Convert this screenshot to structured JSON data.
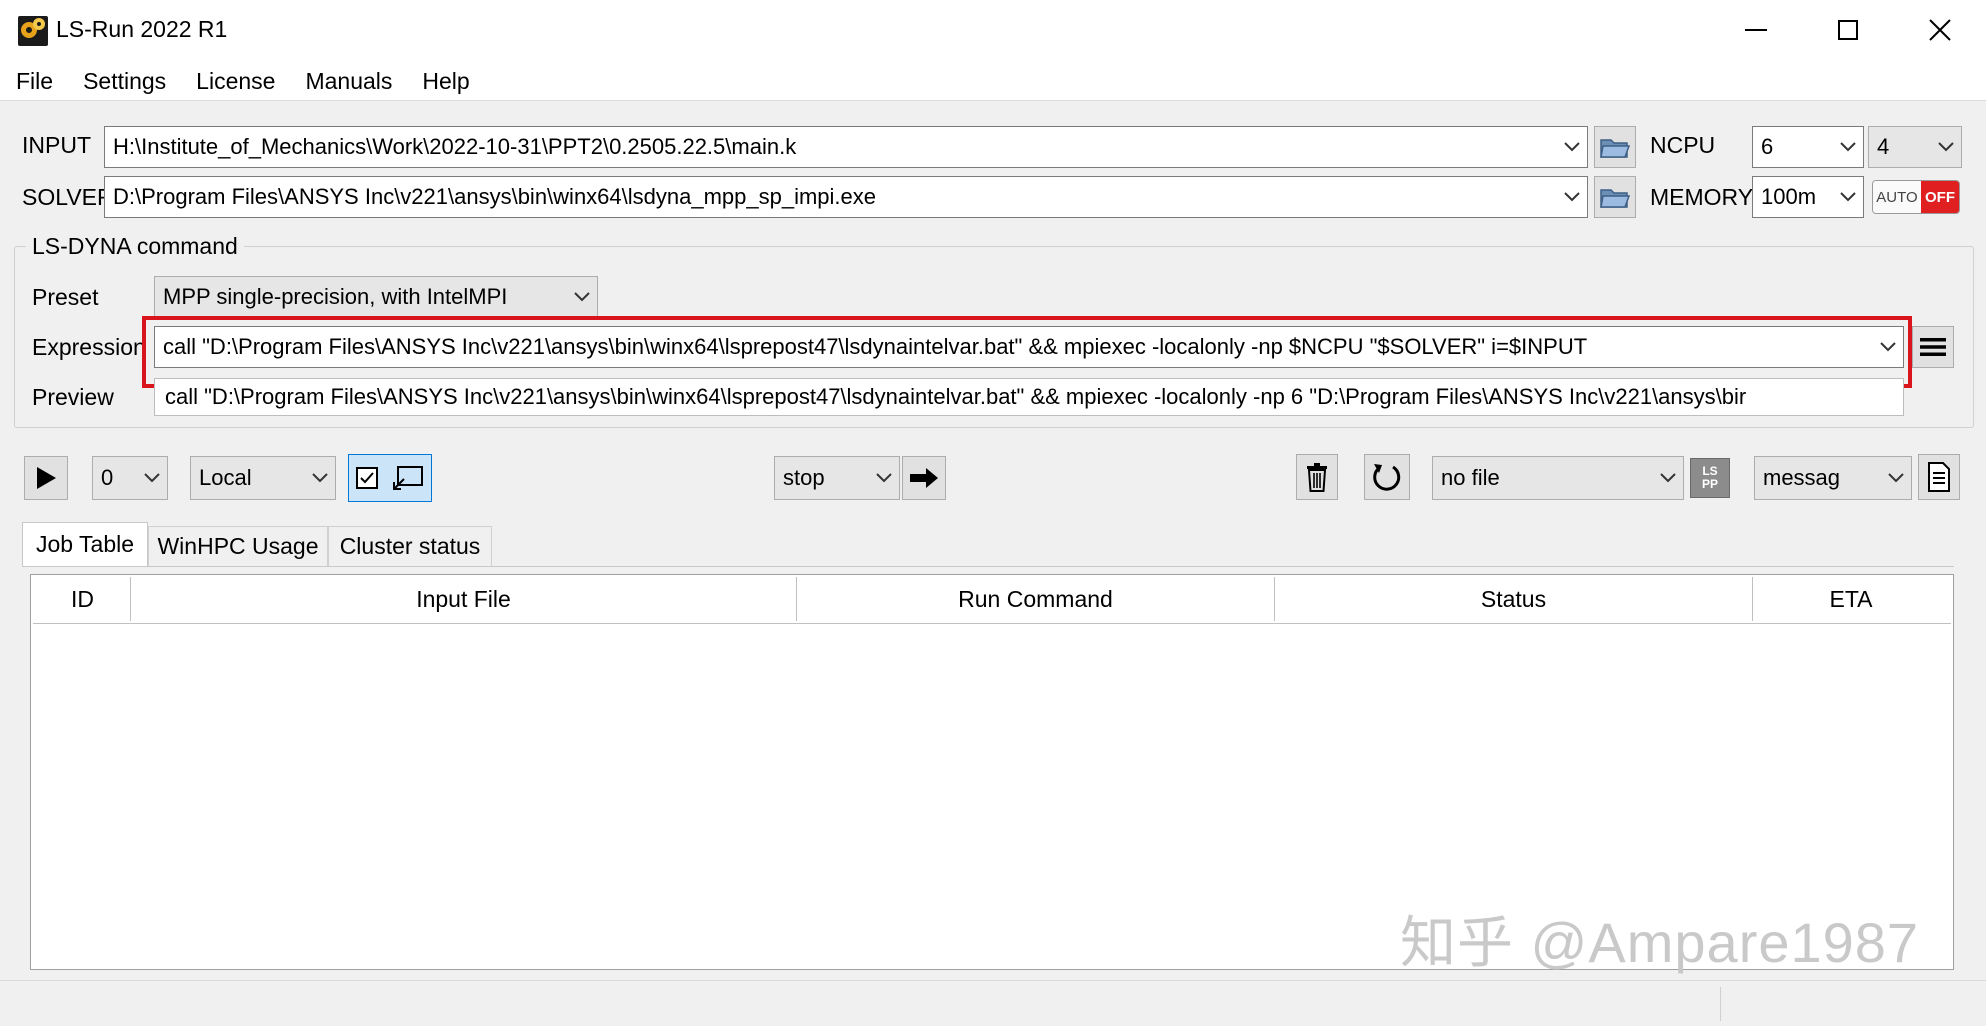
{
  "window": {
    "title": "LS-Run 2022 R1",
    "minimize_glyph": "—",
    "maximize_glyph": "☐",
    "close_glyph": "✕"
  },
  "menu": [
    "File",
    "Settings",
    "License",
    "Manuals",
    "Help"
  ],
  "input": {
    "label": "INPUT",
    "value": "H:\\Institute_of_Mechanics\\Work\\2022-10-31\\PPT2\\0.2505.22.5\\main.k"
  },
  "solver": {
    "label": "SOLVER",
    "value": "D:\\Program Files\\ANSYS Inc\\v221\\ansys\\bin\\winx64\\lsdyna_mpp_sp_impi.exe"
  },
  "ncpu": {
    "label": "NCPU",
    "value": "6",
    "value2": "4"
  },
  "memory": {
    "label": "MEMORY",
    "value": "100m",
    "auto_label": "AUTO",
    "off_label": "OFF"
  },
  "command_group": {
    "title": "LS-DYNA command",
    "preset_label": "Preset",
    "preset_value": "MPP single-precision, with IntelMPI",
    "expression_label": "Expression",
    "expression_value": "call \"D:\\Program Files\\ANSYS Inc\\v221\\ansys\\bin\\winx64\\lsprepost47\\lsdynaintelvar.bat\" && mpiexec -localonly -np $NCPU \"$SOLVER\" i=$INPUT",
    "preview_label": "Preview",
    "preview_value": "call \"D:\\Program Files\\ANSYS Inc\\v221\\ansys\\bin\\winx64\\lsprepost47\\lsdynaintelvar.bat\" && mpiexec -localonly -np 6 \"D:\\Program Files\\ANSYS Inc\\v221\\ansys\\bir"
  },
  "toolbar": {
    "count_value": "0",
    "location_value": "Local",
    "stop_value": "stop",
    "file_value": "no file",
    "lspp_label": "LS\nPP",
    "message_value": "messag"
  },
  "tabs": [
    "Job Table",
    "WinHPC Usage",
    "Cluster status"
  ],
  "table": {
    "columns": [
      "ID",
      "Input File",
      "Run Command",
      "Status",
      "ETA"
    ],
    "rows": []
  },
  "watermark": "知乎 @Ampare1987",
  "colors": {
    "highlight_red": "#d9141c",
    "off_red": "#e02020",
    "background": "#f0f0f0"
  }
}
